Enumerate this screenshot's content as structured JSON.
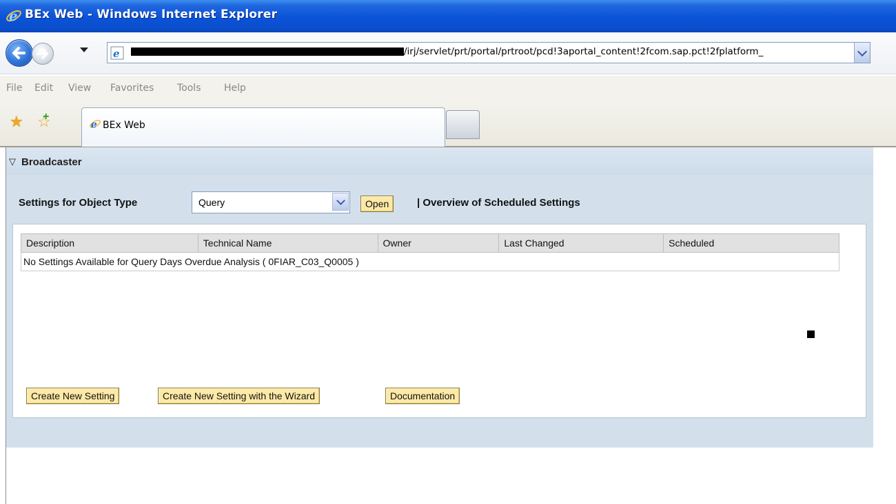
{
  "window": {
    "title": "BEx Web - Windows Internet Explorer",
    "address_url": "/irj/servlet/prt/portal/prtroot/pcd!3aportal_content!2fcom.sap.pct!2fplatform_"
  },
  "menu": [
    "File",
    "Edit",
    "View",
    "Favorites",
    "Tools",
    "Help"
  ],
  "tabs": {
    "active_label": "BEx Web"
  },
  "portal": {
    "panel_title": "Broadcaster",
    "object_type_label": "Settings for Object Type",
    "object_type_value": "Query",
    "open_button": "Open",
    "overview_link": "| Overview of Scheduled Settings",
    "table": {
      "columns": [
        "Description",
        "Technical Name",
        "Owner",
        "Last Changed",
        "Scheduled"
      ],
      "empty_message": "No Settings Available for Query Days Overdue Analysis ( 0FIAR_C03_Q0005 )"
    },
    "buttons": {
      "create_new": "Create New Setting",
      "create_wizard": "Create New Setting with the Wizard",
      "documentation": "Documentation"
    }
  },
  "colors": {
    "titlebar": "#0a53d8",
    "panel_bg": "#d3e0ec",
    "button_bg": "#fde9a6"
  }
}
